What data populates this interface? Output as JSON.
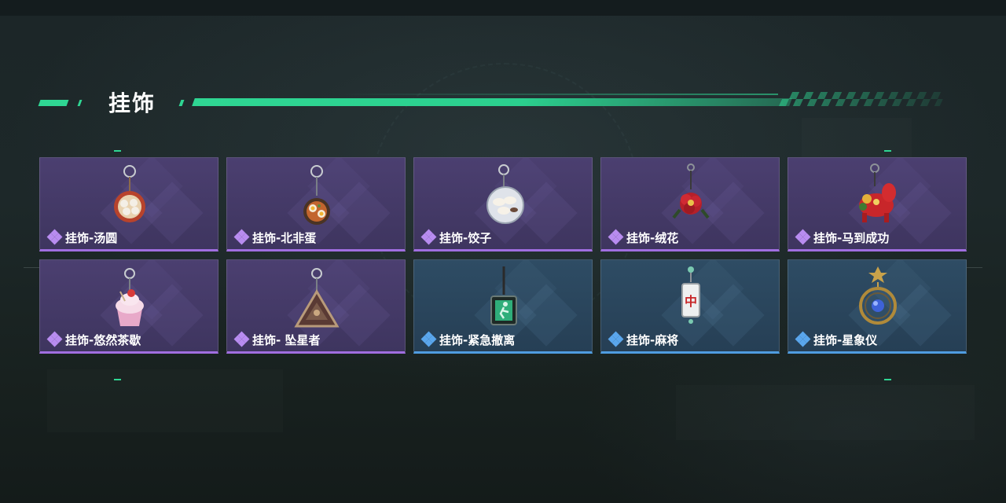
{
  "page": {
    "section_title": "挂饰",
    "accent_color": "#2fd693"
  },
  "items": [
    {
      "label": "挂饰-汤圆",
      "rarity": "purple",
      "icon": "tangyuan-bowl-charm-icon"
    },
    {
      "label": "挂饰-北非蛋",
      "rarity": "purple",
      "icon": "shakshuka-pan-charm-icon"
    },
    {
      "label": "挂饰-饺子",
      "rarity": "purple",
      "icon": "dumpling-plate-charm-icon"
    },
    {
      "label": "挂饰-绒花",
      "rarity": "purple",
      "icon": "velvet-flower-charm-icon"
    },
    {
      "label": "挂饰-马到成功",
      "rarity": "purple",
      "icon": "red-horse-charm-icon"
    },
    {
      "label": "挂饰-悠然茶歇",
      "rarity": "purple",
      "icon": "cupcake-charm-icon"
    },
    {
      "label": "挂饰- 坠星者",
      "rarity": "purple",
      "icon": "triangle-emblem-charm-icon"
    },
    {
      "label": "挂饰-紧急撤离",
      "rarity": "blue",
      "icon": "exit-sign-charm-icon"
    },
    {
      "label": "挂饰-麻将",
      "rarity": "blue",
      "icon": "mahjong-tile-charm-icon"
    },
    {
      "label": "挂饰-星象仪",
      "rarity": "blue",
      "icon": "astrolabe-charm-icon"
    }
  ],
  "rarity_colors": {
    "purple": "#a06ee0",
    "blue": "#4f9ce0"
  },
  "charm_text": {
    "mahjong": "中"
  }
}
